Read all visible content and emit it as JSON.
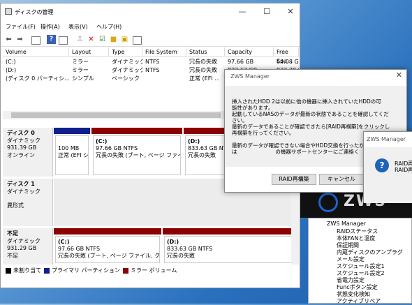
{
  "main_window": {
    "title": "ディスクの管理",
    "controls": [
      "—",
      "☐",
      "✕"
    ],
    "menu": [
      "ファイル(F)",
      "操作(A)",
      "表示(V)",
      "ヘルプ(H)"
    ],
    "toolbar_icons": [
      "back-arrow-icon",
      "forward-arrow-icon",
      "view-icon",
      "view2-icon",
      "help-icon",
      "view3-icon",
      "connect-icon",
      "delete-icon",
      "check-icon",
      "folder-icon",
      "properties-icon",
      "list-icon"
    ]
  },
  "volume_table": {
    "headers": [
      "Volume",
      "Layout",
      "Type",
      "File System",
      "Status",
      "Capacity",
      "Free Spa..."
    ],
    "rows": [
      [
        "(C:)",
        "ミラー",
        "ダイナミック",
        "NTFS",
        "冗長の失敗",
        "97.66 GB",
        "64.08 GB"
      ],
      [
        "(D:)",
        "ミラー",
        "ダイナミック",
        "NTFS",
        "冗長の失敗",
        "833.63 GB",
        "833.38 GB"
      ],
      [
        "(ディスク 0 パーティシ...",
        "シンプル",
        "ベーシック",
        "",
        "正常 (EFI ...",
        "",
        ""
      ]
    ]
  },
  "disks": [
    {
      "name": "ディスク 0",
      "type": "ダイナミック",
      "size": "931.39 GB",
      "state": "オンライン",
      "partitions": [
        {
          "label": "",
          "size": "100 MB",
          "status": "正常 (EFI シ",
          "color": "#0f1f8c"
        },
        {
          "label": "(C:)",
          "size": "97.66 GB NTFS",
          "status": "冗長の失敗 (ブート, ページ ファイル,",
          "color": "#8b0000"
        },
        {
          "label": "(D:)",
          "size": "833.63 GB NTFS",
          "status": "冗長の失敗",
          "color": "#8b0000"
        }
      ]
    },
    {
      "name": "ディスク 1",
      "type": "ダイナミック",
      "size": "",
      "state": "異形式",
      "partitions": []
    },
    {
      "name": "不足",
      "type": "ダイナミック",
      "size": "931.29 GB",
      "state": "不足",
      "partitions": [
        {
          "label": "(C:)",
          "size": "97.66 GB NTFS",
          "status": "冗長の失敗 (ブート, ページ ファイル, クラッシ",
          "color": "#8b0000"
        },
        {
          "label": "(D:)",
          "size": "833.63 GB NTFS",
          "status": "冗長の失敗",
          "color": "#8b0000"
        }
      ]
    }
  ],
  "legend": [
    {
      "label": "未割り当て",
      "color": "#000000"
    },
    {
      "label": "プライマリ パーティション",
      "color": "#0f1f8c"
    },
    {
      "label": "ミラー ボリューム",
      "color": "#8b0000"
    }
  ],
  "dialog": {
    "title": "ZWS Manager",
    "lines": [
      "挿入されたHDD 2は以前に他の機器に挿入されていたHDDの可",
      "能性があります。",
      "起動しているNASのデータが最新の状態であることを確認してくだ",
      "さい。",
      "最新のデータであることが確認できたら[RAID再構築]をクリックし",
      "再構築を行ってください。",
      "",
      "最新のデータが確認できない場合やHDD交換を行ったがこのダイ",
      "は 　　　　　　　の機器サポートセンターにご連絡く"
    ],
    "buttons": [
      "RAID再構築",
      "キャンセル"
    ]
  },
  "dialog2": {
    "title": "ZWS Manager",
    "lines": [
      "RAID再",
      "RAID再"
    ]
  },
  "background": {
    "brand": "ZWS",
    "tree_root": "ZWS Manager",
    "tree_items": [
      "RAIDステータス",
      "本体FANと温度",
      "保証期間",
      "内蔵ディスクのアンプラグ",
      "メール設定",
      "スケジュール設定1",
      "スケジュール設定2",
      "省電力設定",
      "Funcボタン設定",
      "状態変化検知",
      "アクティブリペア"
    ]
  }
}
